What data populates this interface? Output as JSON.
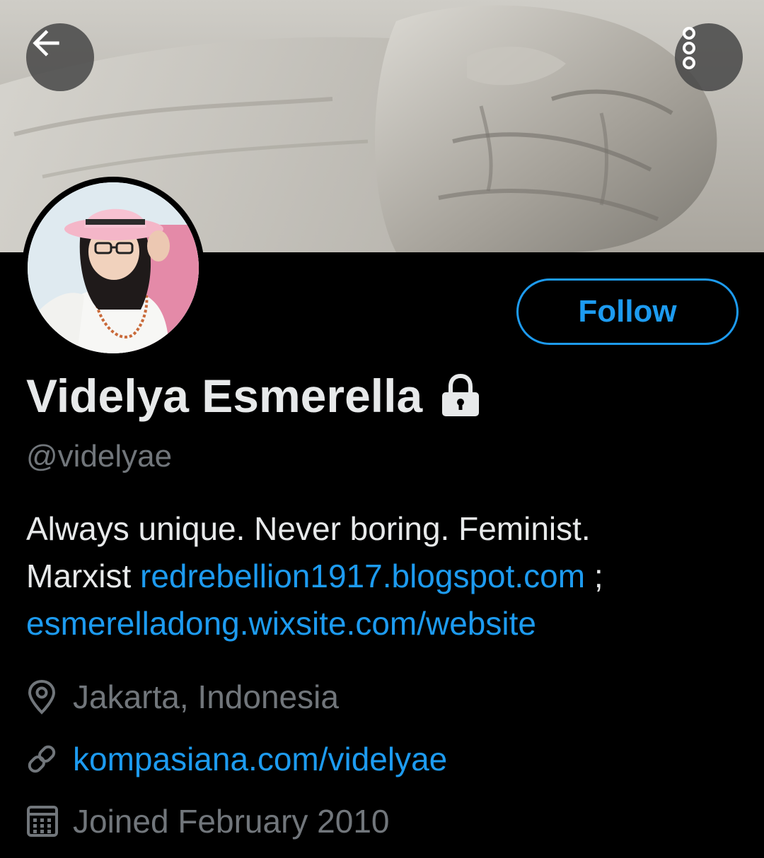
{
  "header": {
    "back_icon": "arrow-left-icon",
    "more_icon": "more-vertical-icon",
    "banner": "banner-image"
  },
  "profile": {
    "avatar": "avatar-image",
    "follow_label": "Follow",
    "display_name": "Videlya Esmerella",
    "protected_icon": "lock-icon",
    "handle": "@videlyae",
    "bio": {
      "line1": "Always unique. Never boring. Feminist.",
      "line2_text": "Marxist ",
      "line2_link": "redrebellion1917.blogspot.com",
      "line2_suffix": " ;",
      "line3_link": "esmerelladong.wixsite.com/website"
    },
    "location": "Jakarta, Indonesia",
    "website": "kompasiana.com/videlyae",
    "joined": "Joined February 2010"
  },
  "colors": {
    "background": "#000000",
    "accent": "#1d9bf0",
    "primary_text": "#e7e9ea",
    "secondary_text": "#71767b"
  }
}
